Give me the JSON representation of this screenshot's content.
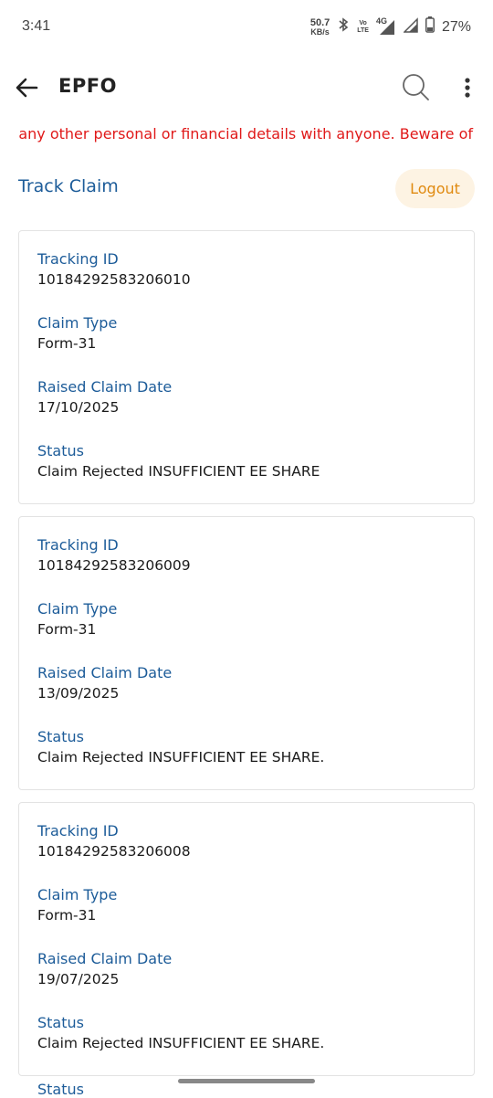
{
  "status_bar": {
    "time": "3:41",
    "net_speed_value": "50.7",
    "net_speed_unit": "KB/s",
    "volte_top": "Vo",
    "volte_bottom": "LTE",
    "network_type": "4G",
    "battery": "27%"
  },
  "app_bar": {
    "title": "EPFO",
    "icons": [
      "back-arrow-icon",
      "search-icon",
      "more-vert-icon"
    ]
  },
  "notice": {
    "text": "any other personal or financial details with anyone. Beware of"
  },
  "page": {
    "title": "Track Claim",
    "logout_label": "Logout"
  },
  "claims": [
    {
      "tracking_label": "Tracking ID",
      "tracking_id": "10184292583206010",
      "type_label": "Claim Type",
      "type": "Form-31",
      "date_label": "Raised Claim Date",
      "date": "17/10/2025",
      "status_label": "Status",
      "status": "Claim Rejected INSUFFICIENT EE SHARE"
    },
    {
      "tracking_label": "Tracking ID",
      "tracking_id": "10184292583206009",
      "type_label": "Claim Type",
      "type": "Form-31",
      "date_label": "Raised Claim Date",
      "date": "13/09/2025",
      "status_label": "Status",
      "status": "Claim Rejected INSUFFICIENT EE SHARE."
    },
    {
      "tracking_label": "Tracking ID",
      "tracking_id": "10184292583206008",
      "type_label": "Claim Type",
      "type": "Form-31",
      "date_label": "Raised Claim Date",
      "date": "19/07/2025",
      "status_label": "Status",
      "status": "Claim Rejected INSUFFICIENT EE SHARE."
    }
  ],
  "partial_next_label": "Status",
  "colors": {
    "label_blue": "#1d5c99",
    "notice_red": "#e01919",
    "logout_orange": "#e08a10",
    "logout_bg": "#fdf3e3"
  }
}
